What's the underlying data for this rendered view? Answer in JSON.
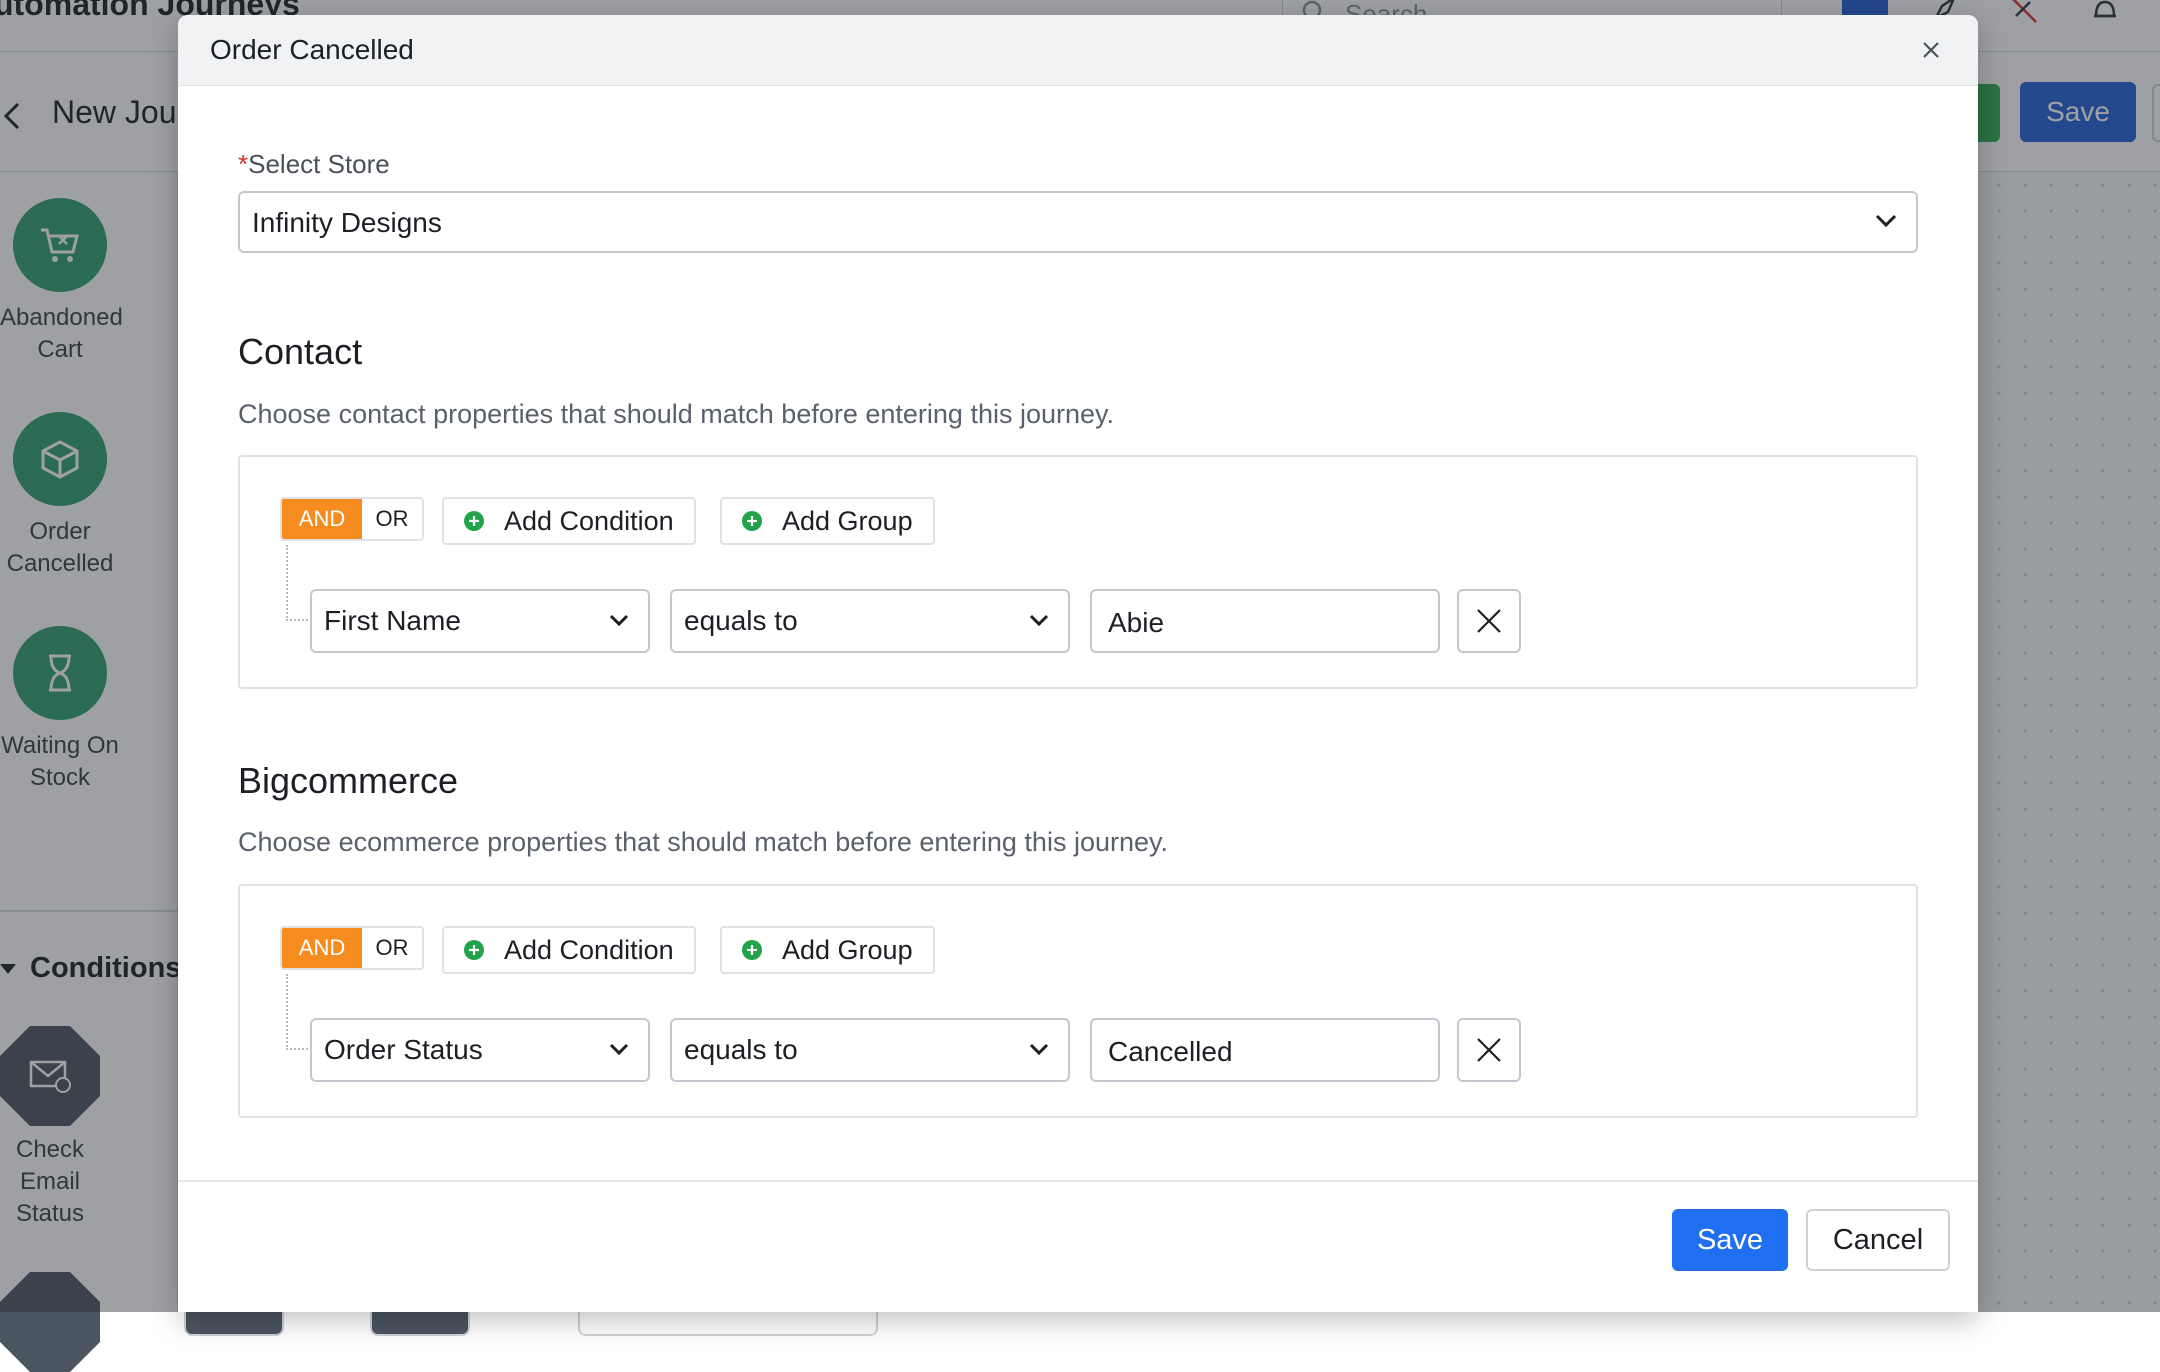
{
  "app": {
    "title": "utomation Journeys",
    "search_placeholder": "Search",
    "journey_name": "New Jou",
    "save_label": "Save"
  },
  "sidebar": {
    "triggers": [
      {
        "label": "Abandoned Cart",
        "icon": "cart-icon"
      },
      {
        "label": "Order Cancelled",
        "icon": "box-icon"
      },
      {
        "label": "Waiting On Stock",
        "icon": "hourglass-icon"
      }
    ],
    "conditions_heading": "Conditions",
    "conditions": [
      {
        "label": "Check Email Status",
        "icon": "email-status-icon"
      }
    ]
  },
  "modal": {
    "title": "Order Cancelled",
    "store_label_required": "*",
    "store_label": "Select Store",
    "store_value": "Infinity Designs",
    "sections": [
      {
        "title": "Contact",
        "description": "Choose contact properties that should match before entering this journey.",
        "and_label": "AND",
        "or_label": "OR",
        "add_condition_label": "Add Condition",
        "add_group_label": "Add Group",
        "condition": {
          "field": "First Name",
          "operator": "equals to",
          "value": "Abie"
        }
      },
      {
        "title": "Bigcommerce",
        "description": "Choose ecommerce properties that should match before entering this journey.",
        "and_label": "AND",
        "or_label": "OR",
        "add_condition_label": "Add Condition",
        "add_group_label": "Add Group",
        "condition": {
          "field": "Order Status",
          "operator": "equals to",
          "value": "Cancelled"
        }
      }
    ],
    "save_label": "Save",
    "cancel_label": "Cancel"
  },
  "colors": {
    "primary": "#1f6ff0",
    "and_active": "#f68b1f",
    "trigger_green": "#2f9e6e",
    "add_icon_green": "#22a34a"
  }
}
